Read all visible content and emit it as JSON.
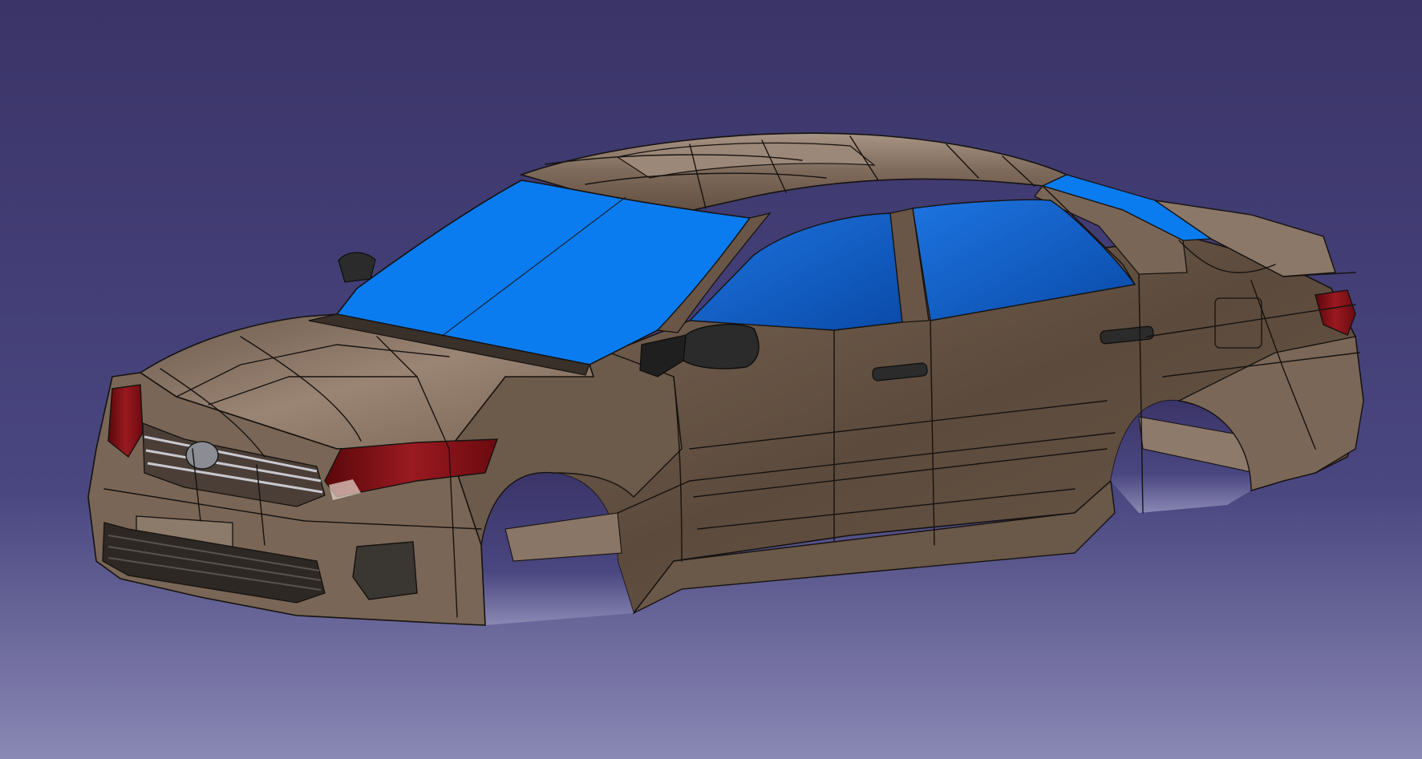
{
  "viewport": {
    "background_top": "#3a3468",
    "background_mid": "#4a4680",
    "background_bottom": "#8a88b4"
  },
  "model": {
    "body_color": "#7e6a5a",
    "body_highlight": "#a89484",
    "body_shadow": "#5e4c3e",
    "glass_color": "#0a7cf0",
    "side_glass_color": "#0d5fc8",
    "lamp_color": "#7a0f14",
    "trim_color": "#2b2b2b",
    "edge_color": "#151210"
  }
}
